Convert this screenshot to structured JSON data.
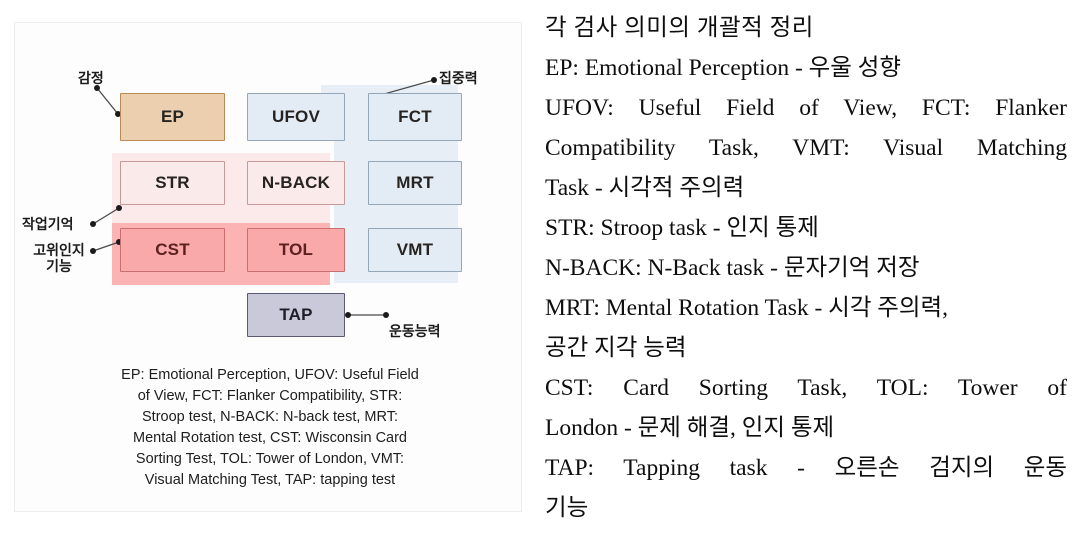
{
  "figure": {
    "boxes": [
      {
        "id": "ep",
        "label": "EP"
      },
      {
        "id": "ufov",
        "label": "UFOV"
      },
      {
        "id": "fct",
        "label": "FCT"
      },
      {
        "id": "str",
        "label": "STR"
      },
      {
        "id": "nback",
        "label": "N-BACK"
      },
      {
        "id": "mrt",
        "label": "MRT"
      },
      {
        "id": "cst",
        "label": "CST"
      },
      {
        "id": "tol",
        "label": "TOL"
      },
      {
        "id": "vmt",
        "label": "VMT"
      },
      {
        "id": "tap",
        "label": "TAP"
      }
    ],
    "annotations": {
      "emotion": "감정",
      "attention": "집중력",
      "working_memory": "작업기억",
      "higher_cognition_line1": "고위인지",
      "higher_cognition_line2": "기능",
      "motor_ability": "운동능력"
    },
    "caption_lines": [
      "EP: Emotional Perception, UFOV: Useful Field",
      "of View, FCT: Flanker Compatibility, STR:",
      "Stroop test, N-BACK: N-back test, MRT:",
      "Mental Rotation test, CST: Wisconsin Card",
      "Sorting Test, TOL: Tower of London, VMT:",
      "Visual Matching Test, TAP: tapping test"
    ],
    "colors": {
      "group_blue": "#e7eef5",
      "group_pink_light": "#fce9e9",
      "group_pink_dark": "#fbb3b3",
      "box_blue_fill": "#e3ecf5",
      "box_tan_fill": "#eccfaf",
      "box_pink_light_fill": "#faeaea",
      "box_pink_dark_fill": "#f9a9a9",
      "box_lavender_fill": "#c9c9da"
    }
  },
  "summary": {
    "title": "각 검사 의미의 개괄적 정리",
    "lines": [
      "EP: Emotional Perception - 우울 성향",
      "UFOV: Useful Field of View, FCT: Flanker",
      "Compatibility Task, VMT: Visual Matching",
      "Task - 시각적 주의력",
      "STR: Stroop task - 인지 통제",
      "N-BACK: N-Back task - 문자기억 저장",
      "MRT: Mental Rotation Task - 시각 주의력,",
      "공간 지각 능력",
      "CST: Card Sorting Task, TOL: Tower of",
      "London - 문제 해결, 인지 통제",
      "TAP: Tapping task - 오른손 검지의 운동",
      "기능"
    ]
  }
}
